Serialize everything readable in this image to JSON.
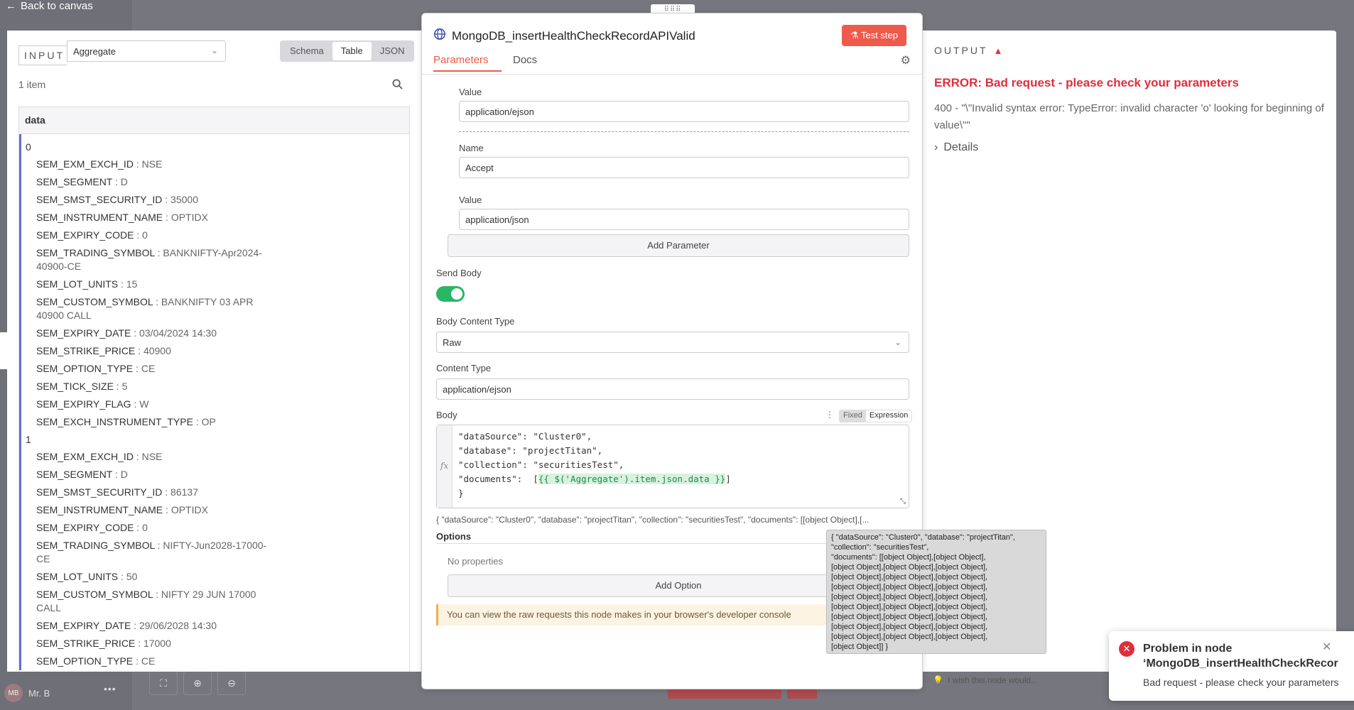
{
  "backdrop": {
    "back_label": "Back to canvas",
    "user_name": "Mr. B",
    "user_initials": "MB",
    "more": "•••"
  },
  "drag_handle": "⠿⠿⠿",
  "input": {
    "title": "INPUT",
    "source": "Aggregate",
    "views": [
      "Schema",
      "Table",
      "JSON"
    ],
    "active_view": "Table",
    "item_count": "1 item",
    "column_header": "data",
    "records": [
      {
        "index": "0",
        "fields": [
          {
            "k": "SEM_EXM_EXCH_ID",
            "v": "NSE"
          },
          {
            "k": "SEM_SEGMENT",
            "v": "D"
          },
          {
            "k": "SEM_SMST_SECURITY_ID",
            "v": "35000"
          },
          {
            "k": "SEM_INSTRUMENT_NAME",
            "v": "OPTIDX"
          },
          {
            "k": "SEM_EXPIRY_CODE",
            "v": "0"
          },
          {
            "k": "SEM_TRADING_SYMBOL",
            "v": "BANKNIFTY-Apr2024-40900-CE"
          },
          {
            "k": "SEM_LOT_UNITS",
            "v": "15"
          },
          {
            "k": "SEM_CUSTOM_SYMBOL",
            "v": "BANKNIFTY 03 APR 40900 CALL"
          },
          {
            "k": "SEM_EXPIRY_DATE",
            "v": "03/04/2024 14:30"
          },
          {
            "k": "SEM_STRIKE_PRICE",
            "v": "40900"
          },
          {
            "k": "SEM_OPTION_TYPE",
            "v": "CE"
          },
          {
            "k": "SEM_TICK_SIZE",
            "v": "5"
          },
          {
            "k": "SEM_EXPIRY_FLAG",
            "v": "W"
          },
          {
            "k": "SEM_EXCH_INSTRUMENT_TYPE",
            "v": "OP"
          }
        ]
      },
      {
        "index": "1",
        "fields": [
          {
            "k": "SEM_EXM_EXCH_ID",
            "v": "NSE"
          },
          {
            "k": "SEM_SEGMENT",
            "v": "D"
          },
          {
            "k": "SEM_SMST_SECURITY_ID",
            "v": "86137"
          },
          {
            "k": "SEM_INSTRUMENT_NAME",
            "v": "OPTIDX"
          },
          {
            "k": "SEM_EXPIRY_CODE",
            "v": "0"
          },
          {
            "k": "SEM_TRADING_SYMBOL",
            "v": "NIFTY-Jun2028-17000-CE"
          },
          {
            "k": "SEM_LOT_UNITS",
            "v": "50"
          },
          {
            "k": "SEM_CUSTOM_SYMBOL",
            "v": "NIFTY 29 JUN 17000 CALL"
          },
          {
            "k": "SEM_EXPIRY_DATE",
            "v": "29/06/2028 14:30"
          },
          {
            "k": "SEM_STRIKE_PRICE",
            "v": "17000"
          },
          {
            "k": "SEM_OPTION_TYPE",
            "v": "CE"
          }
        ]
      }
    ]
  },
  "node": {
    "name": "MongoDB_insertHealthCheckRecordAPIValid",
    "test_button": "Test step",
    "tabs": [
      "Parameters",
      "Docs"
    ],
    "params": {
      "value_label_1": "Value",
      "value_1": "application/ejson",
      "name_label": "Name",
      "name_value": "Accept",
      "value_label_2": "Value",
      "value_2": "application/json",
      "add_parameter": "Add Parameter",
      "send_body_label": "Send Body",
      "send_body_on": true,
      "body_content_type_label": "Body Content Type",
      "body_content_type": "Raw",
      "content_type_label": "Content Type",
      "content_type": "application/ejson",
      "body_label": "Body",
      "mode_fixed": "Fixed",
      "mode_expression": "Expression",
      "fx": "fx",
      "body_code": {
        "l1": "\"dataSource\": \"Cluster0\",",
        "l2": "\"database\": \"projectTitan\",",
        "l3": "\"collection\": \"securitiesTest\",",
        "l4_prefix": "\"documents\":  [",
        "l4_expr": "{{ $('Aggregate').item.json.data }}",
        "l4_suffix": "]",
        "l5": "}"
      },
      "preview": "{  \"dataSource\": \"Cluster0\",  \"database\": \"projectTitan\",  \"collection\": \"securitiesTest\",  \"documents\":  [[object Object],[...",
      "options_label": "Options",
      "no_properties": "No properties",
      "add_option": "Add Option",
      "notice": "You can view the raw requests this node makes in your browser's developer console"
    }
  },
  "tooltip": {
    "lines": [
      "{  \"dataSource\": \"Cluster0\",  \"database\": \"projectTitan\",",
      "\"collection\": \"securitiesTest\",",
      "\"documents\":  [[object Object],[object Object],",
      "[object Object],[object Object],[object Object],",
      "[object Object],[object Object],[object Object],",
      "[object Object],[object Object],[object Object],",
      "[object Object],[object Object],[object Object],",
      "[object Object],[object Object],[object Object],",
      "[object Object],[object Object],[object Object],",
      "[object Object],[object Object],[object Object],",
      "[object Object],[object Object],[object Object],",
      "[object Object]] }"
    ]
  },
  "output": {
    "title": "OUTPUT",
    "error_title": "ERROR: Bad request - please check your parameters",
    "error_message": "400 - \"\\\"Invalid syntax error: TypeError: invalid character 'o' looking for beginning of value\\\"\"",
    "details": "Details",
    "feedback": "I wish this node would..."
  },
  "toast": {
    "title_line1": "Problem in node",
    "title_line2": "‘MongoDB_insertHealthCheckRecor",
    "message": "Bad request - please check your parameters"
  },
  "colors": {
    "accent": "#ee5a4c",
    "error": "#e22d3c",
    "toggle_on": "#29b765",
    "tree_line": "#6a6bd6"
  }
}
